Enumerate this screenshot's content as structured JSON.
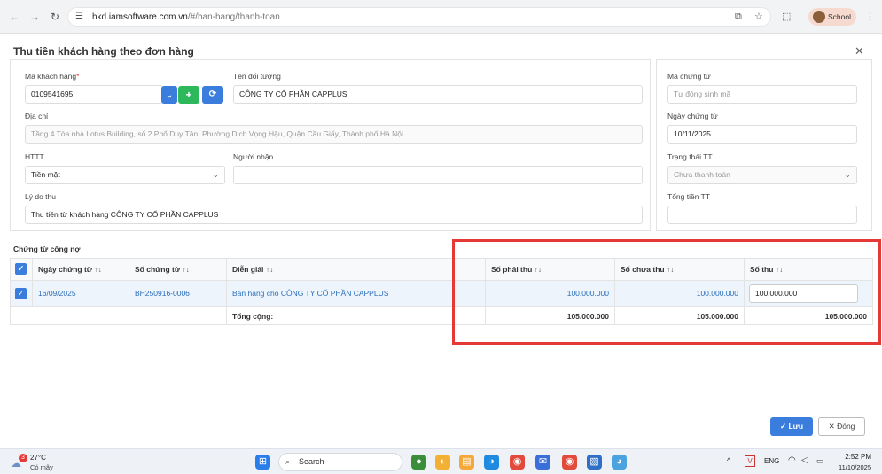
{
  "browser": {
    "url_host": "hkd.iamsoftware.com.vn",
    "url_path": "/#/ban-hang/thanh-toan",
    "profile_label": "School"
  },
  "dialog": {
    "title": "Thu tiền khách hàng theo đơn hàng"
  },
  "form": {
    "ma_khach_hang_label": "Mã khách hàng",
    "ma_khach_hang_required": "*",
    "ma_khach_hang_value": "0109541695",
    "ten_doi_tuong_label": "Tên đối tượng",
    "ten_doi_tuong_value": "CÔNG TY CỔ PHẦN CAPPLUS",
    "dia_chi_label": "Địa chỉ",
    "dia_chi_value": "Tầng 4 Tòa nhà Lotus Building, số 2 Phố Duy Tân, Phường Dịch Vọng Hậu, Quận Cầu Giấy, Thành phố Hà Nội",
    "httt_label": "HTTT",
    "httt_value": "Tiền mặt",
    "nguoi_nhan_label": "Người nhận",
    "nguoi_nhan_value": "",
    "ly_do_thu_label": "Lý do thu",
    "ly_do_thu_value": "Thu tiền từ khách hàng CÔNG TY CỔ PHẦN CAPPLUS",
    "ma_chung_tu_label": "Mã chứng từ",
    "ma_chung_tu_placeholder": "Tự động sinh mã",
    "ngay_chung_tu_label": "Ngày chứng từ",
    "ngay_chung_tu_value": "10/11/2025",
    "trang_thai_tt_label": "Trạng thái TT",
    "trang_thai_tt_value": "Chưa thanh toán",
    "tong_tien_tt_label": "Tổng tiền TT",
    "tong_tien_tt_value": ""
  },
  "section": {
    "chung_tu_cong_no": "Chứng từ công nợ"
  },
  "table": {
    "sort_glyph": "↑↓",
    "headers": {
      "ngay_chung_tu": "Ngày chứng từ",
      "so_chung_tu": "Số chứng từ",
      "dien_giai": "Diễn giải",
      "so_phai_thu": "Số phải thu",
      "so_chua_thu": "Số chưa thu",
      "so_thu": "Số thu"
    },
    "rows": [
      {
        "ngay_chung_tu": "16/09/2025",
        "so_chung_tu": "BH250916-0006",
        "dien_giai": "Bán hàng cho CÔNG TY CỔ PHẦN CAPPLUS",
        "so_phai_thu": "100.000.000",
        "so_chua_thu": "100.000.000",
        "so_thu": "100.000.000"
      }
    ],
    "footer": {
      "label": "Tổng cộng:",
      "so_phai_thu": "105.000.000",
      "so_chua_thu": "105.000.000",
      "so_thu": "105.000.000"
    }
  },
  "actions": {
    "save_label": "Lưu",
    "close_label": "Đóng"
  },
  "taskbar": {
    "weather_temp": "27°C",
    "weather_desc": "Có mây",
    "weather_badge": "3",
    "search_label": "Search",
    "lang": "ENG",
    "time": "2:52 PM",
    "date": "11/10/2025"
  },
  "colors": {
    "accent": "#3b7ddd",
    "add_button": "#2eb85c",
    "highlight_box": "#e53935"
  }
}
